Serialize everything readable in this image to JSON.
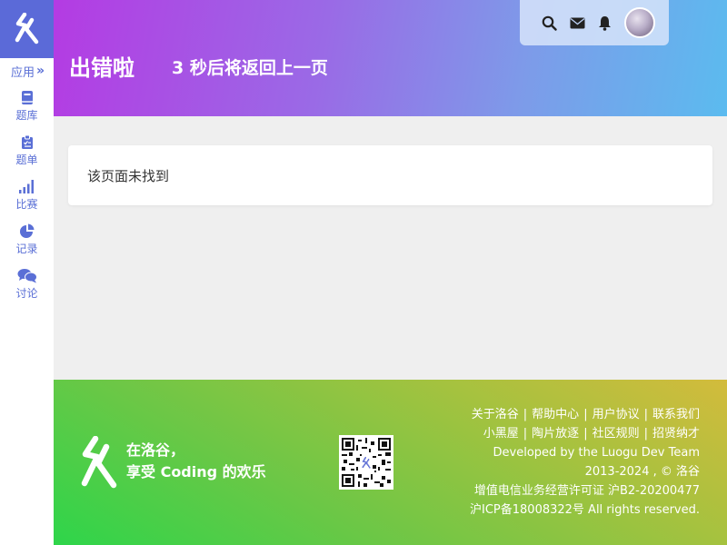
{
  "sidebar": {
    "apps_label": "应用",
    "apps_chevron": "»",
    "items": [
      {
        "label": "题库",
        "icon": "book-icon"
      },
      {
        "label": "题单",
        "icon": "clipboard-icon"
      },
      {
        "label": "比赛",
        "icon": "signal-bars-icon"
      },
      {
        "label": "记录",
        "icon": "pie-chart-icon"
      },
      {
        "label": "讨论",
        "icon": "comments-icon"
      }
    ]
  },
  "header": {
    "title": "出错啦",
    "subtitle": "3 秒后将返回上一页"
  },
  "main": {
    "message": "该页面未找到"
  },
  "footer": {
    "slogan_line1": "在洛谷，",
    "slogan_line2": "享受 Coding 的欢乐",
    "links_row1": [
      "关于洛谷",
      "帮助中心",
      "用户协议",
      "联系我们"
    ],
    "links_row2": [
      "小黑屋",
      "陶片放逐",
      "社区规则",
      "招贤纳才"
    ],
    "developed_prefix": "Developed by the ",
    "developed_team": "Luogu Dev Team",
    "copyright": "2013-2024 , © 洛谷",
    "license": "增值电信业务经营许可证 沪B2-20200477",
    "icp": "沪ICP备18008322号 All rights reserved."
  },
  "colors": {
    "accent": "#5a6fd6",
    "logo_bg": "#5b6ad8",
    "header_gradient_start": "#b43be3",
    "header_gradient_end": "#5bbbef",
    "footer_gradient_start": "#2ed54a",
    "footer_gradient_end": "#d3bb3c"
  }
}
